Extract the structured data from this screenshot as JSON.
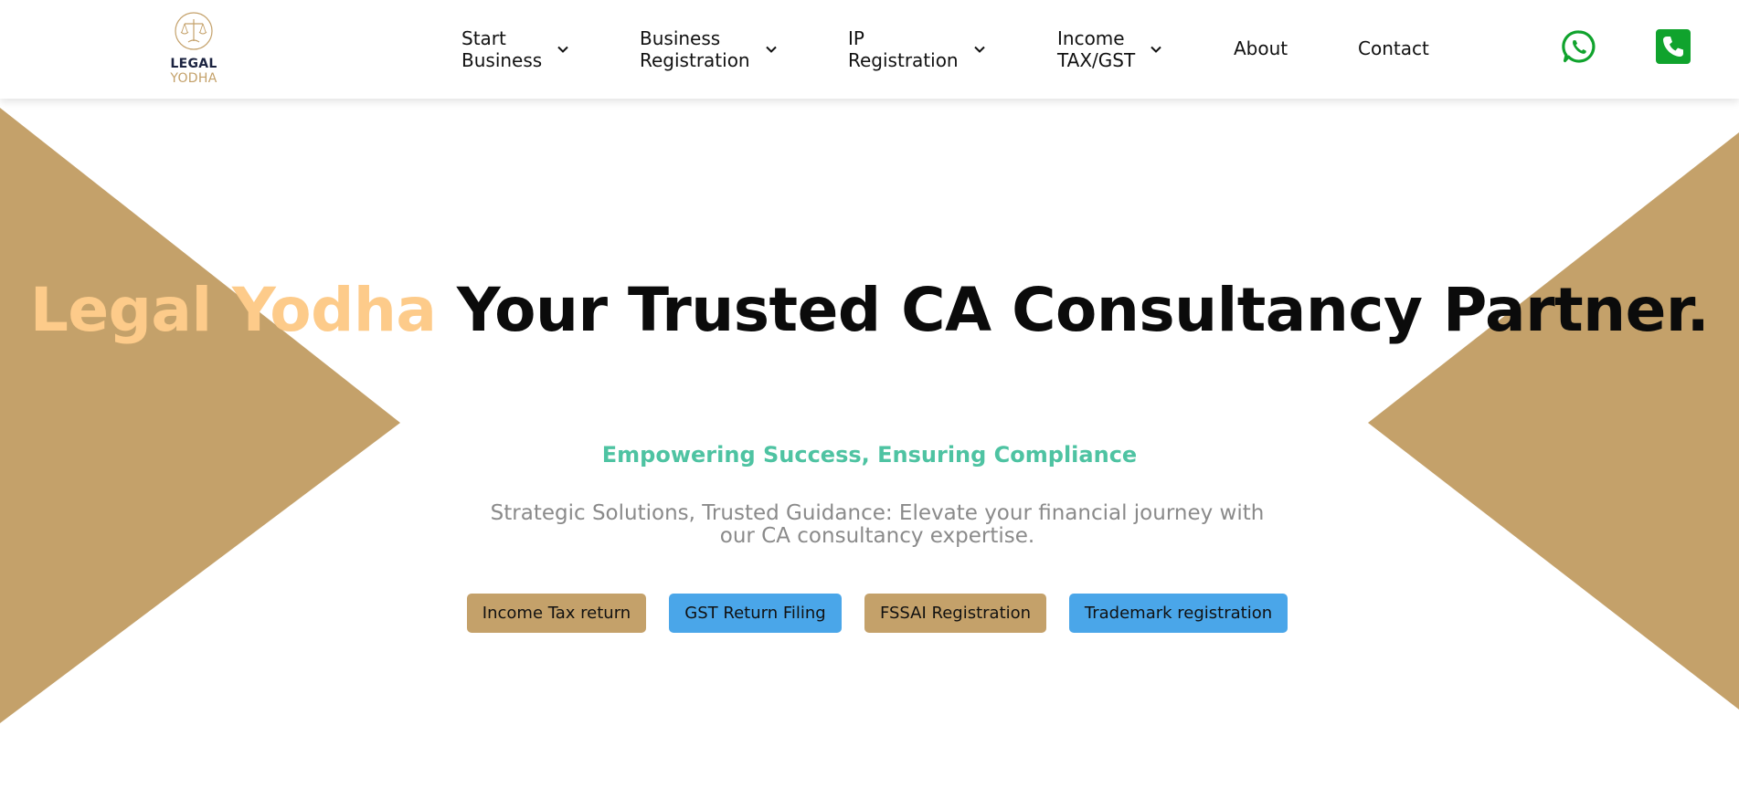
{
  "brand": {
    "name_line1": "LEGAL",
    "name_line2": "YODHA",
    "colors": {
      "gold": "#c4a16a",
      "navy": "#1b2340"
    }
  },
  "nav": {
    "items": [
      {
        "line1": "Start",
        "line2": "Business",
        "has_dropdown": true
      },
      {
        "line1": "Business",
        "line2": "Registration",
        "has_dropdown": true
      },
      {
        "line1": "IP",
        "line2": "Registration",
        "has_dropdown": true
      },
      {
        "line1": "Income",
        "line2": "TAX/GST",
        "has_dropdown": true
      }
    ],
    "about": "About",
    "contact": "Contact",
    "icons": {
      "whatsapp": "whatsapp-icon",
      "phone": "phone-icon"
    },
    "icon_color": "#10a32d"
  },
  "hero": {
    "title_accent": "Legal Yodha",
    "title_rest": " Your Trusted CA Consultancy Partner.",
    "tagline": "Empowering Success, Ensuring Compliance",
    "description": "Strategic Solutions, Trusted Guidance: Elevate your financial journey with our CA consultancy expertise.",
    "colors": {
      "accent": "#fdcb8a",
      "tagline": "#4ec3a2",
      "triangle": "#c4a16a"
    }
  },
  "services": [
    {
      "label": "Income Tax return",
      "style": "gold"
    },
    {
      "label": "GST Return Filing",
      "style": "blue"
    },
    {
      "label": "FSSAI Registration",
      "style": "gold"
    },
    {
      "label": "Trademark registration",
      "style": "blue"
    }
  ]
}
